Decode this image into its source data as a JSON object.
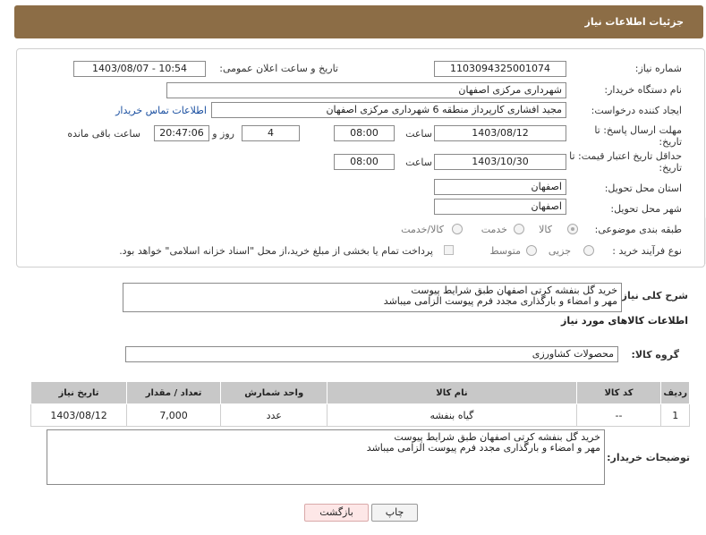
{
  "header": {
    "title": "جزئیات اطلاعات نیاز"
  },
  "watermark": "AriaTender.neT",
  "form": {
    "need_number_label": "شماره نیاز:",
    "need_number": "1103094325001074",
    "announce_label": "تاریخ و ساعت اعلان عمومی:",
    "announce_value": "1403/08/07 - 10:54",
    "buyer_org_label": "نام دستگاه خریدار:",
    "buyer_org": "شهرداری مرکزی اصفهان",
    "creator_label": "ایجاد کننده درخواست:",
    "creator": "مجید افشاری کارپرداز منطقه 6 شهرداری مرکزی اصفهان",
    "contact_link": "اطلاعات تماس خریدار",
    "deadline_label": "مهلت ارسال پاسخ: تا",
    "deadline_label2": "تاریخ:",
    "deadline_date": "1403/08/12",
    "time_word": "ساعت",
    "deadline_time": "08:00",
    "days_value": "4",
    "days_word": "روز و",
    "remaining_time": "20:47:06",
    "remaining_word": "ساعت باقی مانده",
    "validity_label": "حداقل تاریخ اعتبار قیمت: تا",
    "validity_label2": "تاریخ:",
    "validity_date": "1403/10/30",
    "validity_time": "08:00",
    "province_label": "استان محل تحویل:",
    "province": "اصفهان",
    "city_label": "شهر محل تحویل:",
    "city": "اصفهان",
    "category_label": "طبقه بندی موضوعی:",
    "category_options": [
      "کالا",
      "خدمت",
      "کالا/خدمت"
    ],
    "purchase_label": "نوع فرآیند خرید :",
    "purchase_options": [
      "جزیی",
      "متوسط"
    ],
    "payment_note": "پرداخت تمام یا بخشی از مبلغ خرید،از محل \"اسناد خزانه اسلامی\" خواهد بود."
  },
  "summary": {
    "label": "شرح کلی نیاز:",
    "text": "خرید گل بنفشه کرتی اصفهان طبق شرایط پیوست\nمهر و امضاء و بارگذاری مجدد فرم پیوست الزامی میباشد"
  },
  "goods": {
    "section_title": "اطلاعات کالاهای مورد نیاز",
    "group_label": "گروه کالا:",
    "group_value": "محصولات کشاورزی",
    "columns": [
      "ردیف",
      "کد کالا",
      "نام کالا",
      "واحد شمارش",
      "تعداد / مقدار",
      "تاریخ نیاز"
    ],
    "rows": [
      [
        "1",
        "--",
        "گیاه بنفشه",
        "عدد",
        "7,000",
        "1403/08/12"
      ]
    ]
  },
  "buyer_notes": {
    "label": "توضیحات خریدار:",
    "text": "خرید گل بنفشه کرتی اصفهان طبق شرایط پیوست\nمهر و امضاء و بارگذاری مجدد فرم پیوست الزامی میباشد"
  },
  "buttons": {
    "print": "چاپ",
    "back": "بازگشت"
  }
}
